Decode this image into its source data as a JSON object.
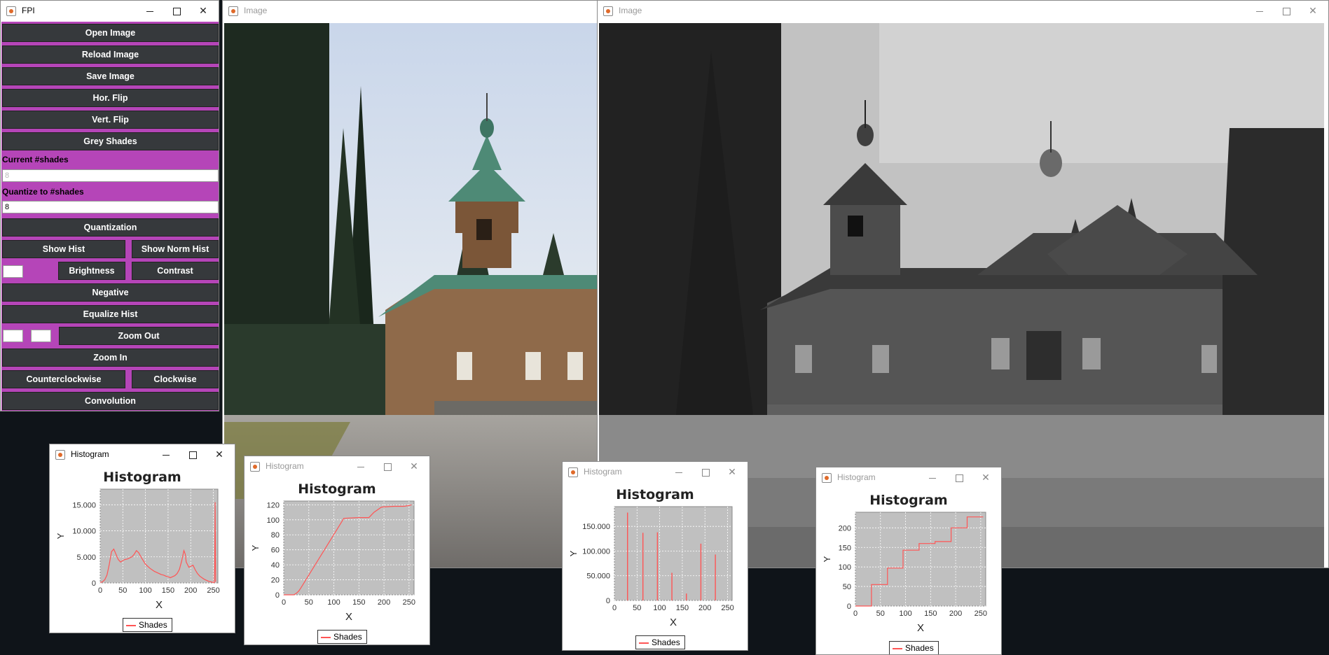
{
  "fpi": {
    "title": "FPI",
    "buttons": {
      "open": "Open Image",
      "reload": "Reload Image",
      "save": "Save Image",
      "hflip": "Hor. Flip",
      "vflip": "Vert. Flip",
      "grey": "Grey Shades",
      "quant": "Quantization",
      "show_hist": "Show Hist",
      "show_norm": "Show Norm Hist",
      "brightness": "Brightness",
      "contrast": "Contrast",
      "negative": "Negative",
      "equalize": "Equalize Hist",
      "zoom_out": "Zoom Out",
      "zoom_in": "Zoom In",
      "ccw": "Counterclockwise",
      "cw": "Clockwise",
      "convolution": "Convolution"
    },
    "current_shades_label": "Current #shades",
    "current_shades_value": "8",
    "quantize_label": "Quantize to #shades",
    "quantize_value": "8"
  },
  "image_windows": [
    {
      "title": "Image"
    },
    {
      "title": "Image"
    }
  ],
  "colors": {
    "panel": "#b545b8",
    "button": "#36393c",
    "plot_bg": "#c0c0c0",
    "series": "#ff5555"
  },
  "histograms": [
    {
      "title": "Histogram",
      "chart_data": {
        "type": "line",
        "title": "Histogram",
        "xlabel": "X",
        "ylabel": "Y",
        "xlim": [
          0,
          260
        ],
        "ylim": [
          0,
          18000
        ],
        "xticks": [
          "0",
          "50",
          "100",
          "150",
          "200",
          "250"
        ],
        "yticks": [
          {
            "v": 0,
            "label": "0"
          },
          {
            "v": 5000,
            "label": "5.000"
          },
          {
            "v": 10000,
            "label": "10.000"
          },
          {
            "v": 15000,
            "label": "15.000"
          }
        ],
        "series": [
          {
            "name": "Shades",
            "x": [
              0,
              5,
              10,
              15,
              20,
              25,
              30,
              35,
              40,
              45,
              50,
              55,
              60,
              65,
              70,
              75,
              80,
              85,
              90,
              95,
              100,
              105,
              110,
              115,
              120,
              125,
              130,
              135,
              140,
              145,
              150,
              155,
              160,
              165,
              170,
              175,
              180,
              185,
              188,
              190,
              193,
              196,
              200,
              205,
              210,
              215,
              220,
              225,
              230,
              235,
              240,
              245,
              250,
              252,
              253,
              254,
              255
            ],
            "values": [
              100,
              200,
              600,
              1500,
              3500,
              6000,
              6500,
              5500,
              4500,
              4000,
              4300,
              4500,
              4600,
              4800,
              5000,
              5500,
              6200,
              5800,
              5000,
              4300,
              3600,
              3200,
              2800,
              2500,
              2200,
              2000,
              1800,
              1600,
              1500,
              1300,
              1200,
              1000,
              1200,
              1400,
              1800,
              2600,
              4200,
              6200,
              5500,
              4000,
              3500,
              3000,
              3200,
              3400,
              2500,
              1800,
              1300,
              1000,
              700,
              500,
              300,
              200,
              100,
              50,
              3000,
              15500,
              200
            ]
          }
        ]
      }
    },
    {
      "title": "Histogram",
      "chart_data": {
        "type": "line",
        "title": "Histogram",
        "xlabel": "X",
        "ylabel": "Y",
        "xlim": [
          0,
          260
        ],
        "ylim": [
          0,
          125
        ],
        "xticks": [
          "0",
          "50",
          "100",
          "150",
          "200",
          "250"
        ],
        "yticks": [
          {
            "v": 0,
            "label": "0"
          },
          {
            "v": 20,
            "label": "20"
          },
          {
            "v": 40,
            "label": "40"
          },
          {
            "v": 60,
            "label": "60"
          },
          {
            "v": 80,
            "label": "80"
          },
          {
            "v": 100,
            "label": "100"
          },
          {
            "v": 120,
            "label": "120"
          }
        ],
        "series": [
          {
            "name": "Shades",
            "x": [
              0,
              20,
              25,
              30,
              35,
              120,
              150,
              170,
              180,
              195,
              220,
              240,
              250,
              255
            ],
            "values": [
              0,
              0,
              2,
              5,
              10,
              102,
              103,
              103,
              110,
              117,
              118,
              118,
              119,
              120
            ]
          }
        ]
      }
    },
    {
      "title": "Histogram",
      "chart_data": {
        "type": "line",
        "title": "Histogram",
        "xlabel": "X",
        "ylabel": "Y",
        "xlim": [
          0,
          260
        ],
        "ylim": [
          0,
          190000
        ],
        "xticks": [
          "0",
          "50",
          "100",
          "150",
          "200",
          "250"
        ],
        "yticks": [
          {
            "v": 0,
            "label": "0"
          },
          {
            "v": 50000,
            "label": "50.000"
          },
          {
            "v": 100000,
            "label": "100.000"
          },
          {
            "v": 150000,
            "label": "150.000"
          }
        ],
        "series": [
          {
            "name": "Shades",
            "spikes": [
              {
                "x": 29,
                "y": 178000
              },
              {
                "x": 63,
                "y": 137000
              },
              {
                "x": 95,
                "y": 138000
              },
              {
                "x": 127,
                "y": 56000
              },
              {
                "x": 159,
                "y": 14000
              },
              {
                "x": 191,
                "y": 115000
              },
              {
                "x": 223,
                "y": 93000
              }
            ]
          }
        ]
      }
    },
    {
      "title": "Histogram",
      "chart_data": {
        "type": "line",
        "title": "Histogram",
        "xlabel": "X",
        "ylabel": "Y",
        "xlim": [
          0,
          260
        ],
        "ylim": [
          0,
          240
        ],
        "xticks": [
          "0",
          "50",
          "100",
          "150",
          "200",
          "250"
        ],
        "yticks": [
          {
            "v": 0,
            "label": "0"
          },
          {
            "v": 50,
            "label": "50"
          },
          {
            "v": 100,
            "label": "100"
          },
          {
            "v": 150,
            "label": "150"
          },
          {
            "v": 200,
            "label": "200"
          }
        ],
        "series": [
          {
            "name": "Shades",
            "x": [
              0,
              32,
              32,
              64,
              64,
              95,
              95,
              127,
              127,
              159,
              159,
              191,
              191,
              223,
              223,
              255
            ],
            "values": [
              0,
              0,
              55,
              55,
              97,
              97,
              143,
              143,
              160,
              160,
              165,
              165,
              200,
              200,
              228,
              228
            ]
          }
        ]
      }
    }
  ]
}
